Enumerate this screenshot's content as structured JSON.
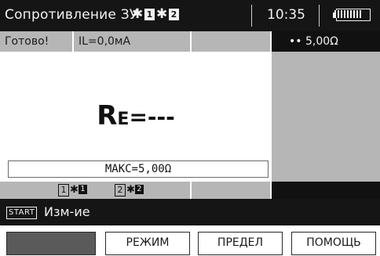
{
  "header": {
    "title": "Сопротивление ЗУ",
    "probe1_label": "1",
    "probe2_label": "2",
    "time": "10:35",
    "battery_level": 0.9
  },
  "status": {
    "ready_text": "Готово!",
    "current_text": "IL=0,0мА",
    "range_text": "•• 5,00Ω"
  },
  "measurement": {
    "symbol_main": "R",
    "symbol_sub": "E",
    "value": "=---"
  },
  "limit": {
    "text": "МАКС=5,00Ω"
  },
  "probe_status": {
    "probe1_num": "1",
    "probe1_sup": "1",
    "probe2_num": "2",
    "probe2_sup": "2"
  },
  "hint": {
    "key": "START",
    "text": "Изм-ие"
  },
  "softkeys": {
    "key1": "",
    "key2": "РЕЖИМ",
    "key3": "ПРЕДЕЛ",
    "key4": "ПОМОЩЬ"
  },
  "colors": {
    "bar_dark": "#151515",
    "panel_gray": "#b6b6b6",
    "blank_key": "#5a5a5a"
  }
}
